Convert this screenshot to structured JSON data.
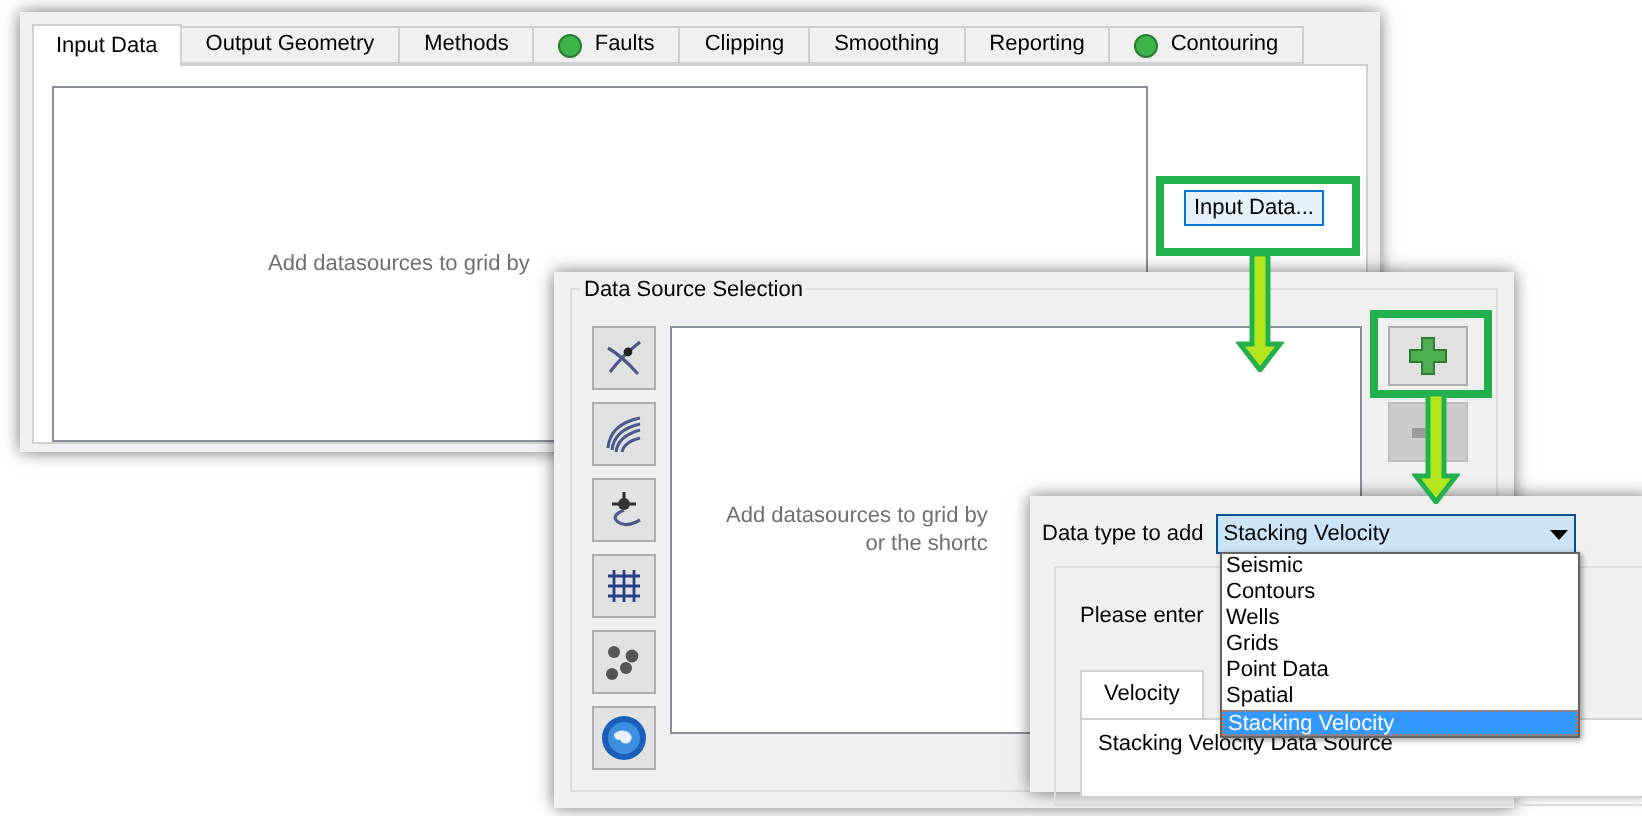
{
  "main_window": {
    "tabs": [
      {
        "label": "Input Data",
        "selected": true,
        "indicator": false
      },
      {
        "label": "Output Geometry",
        "selected": false,
        "indicator": false
      },
      {
        "label": "Methods",
        "selected": false,
        "indicator": false
      },
      {
        "label": "Faults",
        "selected": false,
        "indicator": true
      },
      {
        "label": "Clipping",
        "selected": false,
        "indicator": false
      },
      {
        "label": "Smoothing",
        "selected": false,
        "indicator": false
      },
      {
        "label": "Reporting",
        "selected": false,
        "indicator": false
      },
      {
        "label": "Contouring",
        "selected": false,
        "indicator": true
      }
    ],
    "hint": "Add datasources to grid by",
    "input_data_button": "Input Data..."
  },
  "data_source_dialog": {
    "group_title": "Data Source Selection",
    "source_buttons": [
      {
        "kind": "seismic"
      },
      {
        "kind": "contours"
      },
      {
        "kind": "wells"
      },
      {
        "kind": "grids"
      },
      {
        "kind": "points"
      },
      {
        "kind": "spatial"
      }
    ],
    "hint_lines": [
      "Add datasources to grid by",
      "or the shortc"
    ],
    "remove_disabled": true
  },
  "data_type_popup": {
    "label": "Data type to add",
    "combo_value": "Stacking Velocity",
    "options": [
      {
        "label": "Seismic",
        "selected": false
      },
      {
        "label": "Contours",
        "selected": false
      },
      {
        "label": "Wells",
        "selected": false
      },
      {
        "label": "Grids",
        "selected": false
      },
      {
        "label": "Point Data",
        "selected": false
      },
      {
        "label": "Spatial",
        "selected": false
      },
      {
        "label": "Stacking Velocity",
        "selected": true
      }
    ],
    "prompt": "Please enter",
    "tabs": [
      {
        "label": "Velocity",
        "selected": true
      }
    ],
    "group_title": "Stacking Velocity Data Source"
  }
}
